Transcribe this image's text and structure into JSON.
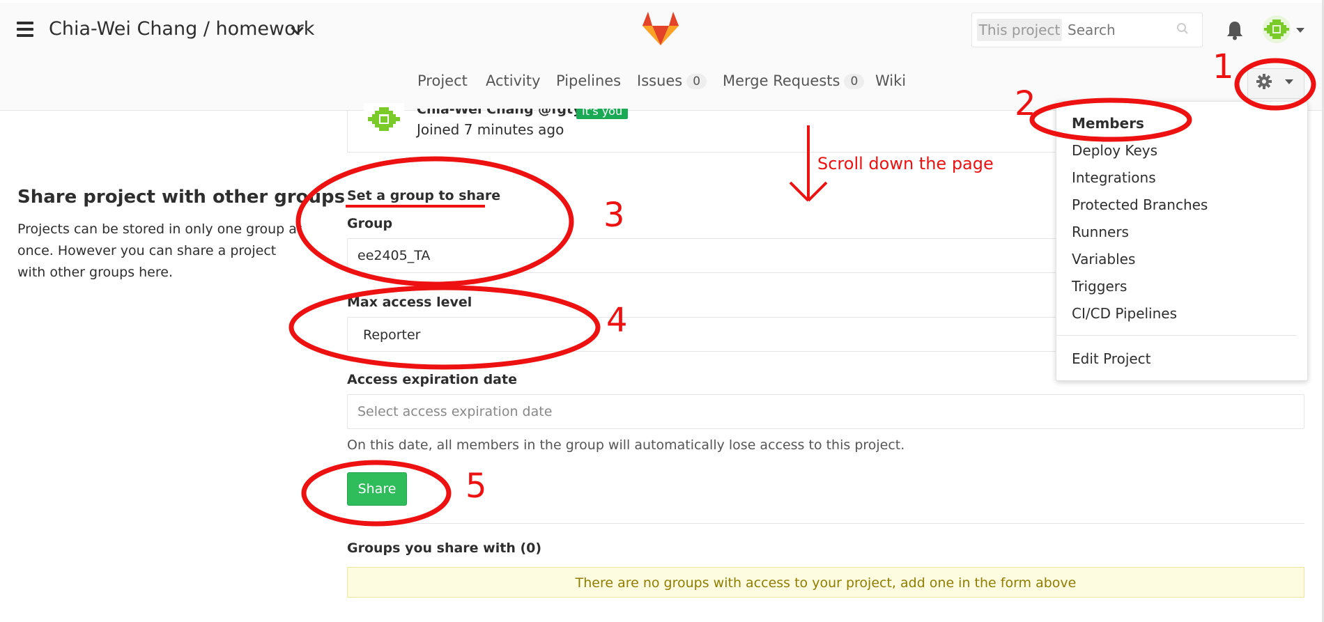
{
  "header": {
    "breadcrumb": "Chia-Wei Chang / homework",
    "search_scope": "This project",
    "search_placeholder": "Search"
  },
  "nav": {
    "items": [
      {
        "label": "Project"
      },
      {
        "label": "Activity"
      },
      {
        "label": "Pipelines"
      },
      {
        "label": "Issues",
        "count": "0"
      },
      {
        "label": "Merge Requests",
        "count": "0"
      },
      {
        "label": "Wiki"
      }
    ]
  },
  "member": {
    "name": "Chia-Wei Chang @fgty",
    "badge": "It's you",
    "joined": "Joined 7 minutes ago"
  },
  "share_section": {
    "title": "Share project with other groups",
    "description": "Projects can be stored in only one group at once. However you can share a project with other groups here."
  },
  "form": {
    "section_heading": "Set a group to share",
    "group_label": "Group",
    "group_value": "ee2405_TA",
    "access_label": "Max access level",
    "access_value": "Reporter",
    "expiry_label": "Access expiration date",
    "expiry_placeholder": "Select access expiration date",
    "expiry_help": "On this date, all members in the group will automatically lose access to this project.",
    "share_button": "Share",
    "shared_title": "Groups you share with (0)",
    "empty_message": "There are no groups with access to your project, add one in the form above"
  },
  "settings_menu": {
    "items": [
      {
        "label": "Members",
        "active": true
      },
      {
        "label": "Deploy Keys"
      },
      {
        "label": "Integrations"
      },
      {
        "label": "Protected Branches"
      },
      {
        "label": "Runners"
      },
      {
        "label": "Variables"
      },
      {
        "label": "Triggers"
      },
      {
        "label": "CI/CD Pipelines"
      }
    ],
    "footer_item": "Edit Project"
  },
  "annotations": {
    "step_numbers": [
      "1",
      "2",
      "3",
      "4",
      "5"
    ],
    "scroll_note": "Scroll down the page",
    "color": "#ee1111"
  },
  "colors": {
    "share_button": "#2fbc5b",
    "alert_bg": "#fdfce0",
    "alert_text": "#8f7d00"
  }
}
